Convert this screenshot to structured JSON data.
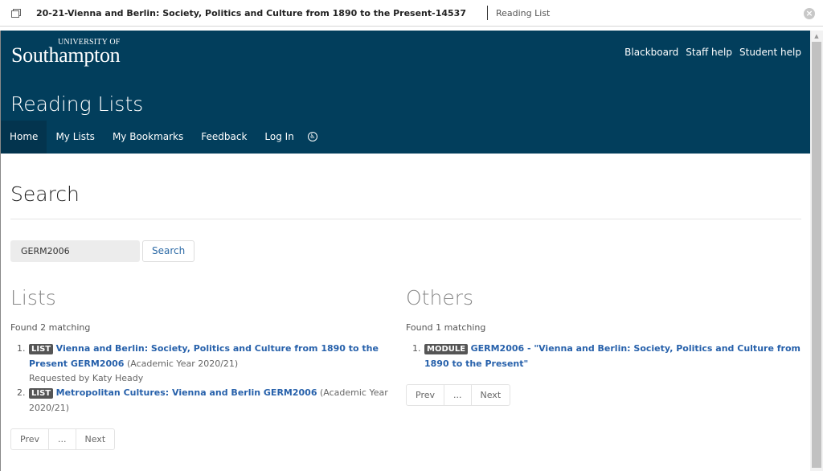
{
  "window": {
    "doc_title": "20-21-Vienna and Berlin: Society, Politics and Culture from 1890 to the Present-14537",
    "app_name": "Reading List",
    "close_symbol": "×"
  },
  "header": {
    "logo_top": "UNIVERSITY OF",
    "logo_main": "Southampton",
    "top_links": [
      "Blackboard",
      "Staff help",
      "Student help"
    ],
    "site_title": "Reading Lists",
    "nav": [
      "Home",
      "My Lists",
      "My Bookmarks",
      "Feedback",
      "Log In"
    ],
    "accessibility_symbol": "♿"
  },
  "main": {
    "heading": "Search",
    "search": {
      "value": "GERM2006",
      "button": "Search"
    },
    "lists": {
      "heading": "Lists",
      "found": "Found 2 matching",
      "items": [
        {
          "badge": "LIST",
          "title": "Vienna and Berlin: Society, Politics and Culture from 1890 to the Present GERM2006",
          "meta": "(Academic Year 2020/21)",
          "requested": "Requested by Katy Heady"
        },
        {
          "badge": "LIST",
          "title": "Metropolitan Cultures: Vienna and Berlin GERM2006",
          "meta": "(Academic Year 2020/21)"
        }
      ],
      "pager": [
        "Prev",
        "...",
        "Next"
      ]
    },
    "others": {
      "heading": "Others",
      "found": "Found 1 matching",
      "items": [
        {
          "badge": "MODULE",
          "title": "GERM2006 - \"Vienna and Berlin: Society, Politics and Culture from 1890 to the Present\""
        }
      ],
      "pager": [
        "Prev",
        "...",
        "Next"
      ]
    }
  },
  "colors": {
    "brand": "#023e5c",
    "link": "#2761ab"
  }
}
